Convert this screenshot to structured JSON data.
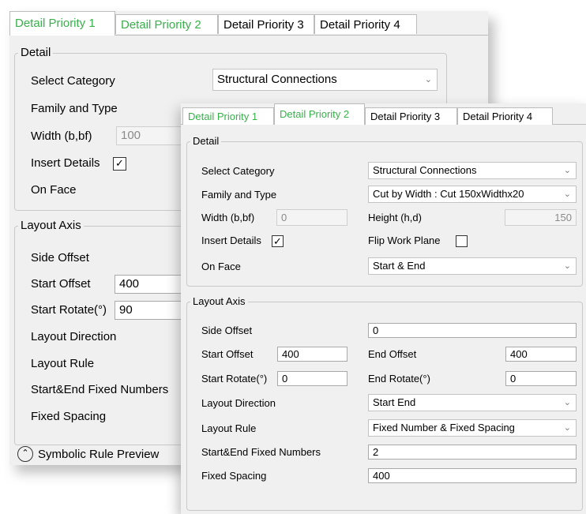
{
  "back": {
    "tabs": [
      "Detail Priority 1",
      "Detail Priority 2",
      "Detail Priority 3",
      "Detail Priority 4"
    ],
    "detail": {
      "legend": "Detail",
      "select_category_label": "Select Category",
      "select_category_value": "Structural Connections",
      "family_type_label": "Family and Type",
      "width_label": "Width (b,bf)",
      "width_value": "100",
      "insert_details_label": "Insert Details",
      "insert_details_checked": "✓",
      "on_face_label": "On Face"
    },
    "layout": {
      "legend": "Layout Axis",
      "side_offset_label": "Side Offset",
      "start_offset_label": "Start Offset",
      "start_offset_value": "400",
      "start_rotate_label": "Start Rotate(°)",
      "start_rotate_value": "90",
      "layout_direction_label": "Layout Direction",
      "layout_rule_label": "Layout Rule",
      "fixed_numbers_label": "Start&End Fixed Numbers",
      "fixed_spacing_label": "Fixed Spacing"
    },
    "symbolic_preview": "Symbolic Rule Preview",
    "symbolic_icon": "⌃"
  },
  "front": {
    "tabs": [
      "Detail Priority 1",
      "Detail Priority 2",
      "Detail Priority 3",
      "Detail Priority 4"
    ],
    "detail": {
      "legend": "Detail",
      "select_category_label": "Select Category",
      "select_category_value": "Structural Connections",
      "family_type_label": "Family and Type",
      "family_type_value": "Cut by Width : Cut 150xWidthx20",
      "width_label": "Width (b,bf)",
      "width_value": "0",
      "height_label": "Height (h,d)",
      "height_value": "150",
      "insert_details_label": "Insert Details",
      "insert_details_checked": "✓",
      "flip_label": "Flip Work Plane",
      "on_face_label": "On Face",
      "on_face_value": "Start & End"
    },
    "layout": {
      "legend": "Layout Axis",
      "side_offset_label": "Side Offset",
      "side_offset_value": "0",
      "start_offset_label": "Start Offset",
      "start_offset_value": "400",
      "end_offset_label": "End Offset",
      "end_offset_value": "400",
      "start_rotate_label": "Start Rotate(°)",
      "start_rotate_value": "0",
      "end_rotate_label": "End Rotate(°)",
      "end_rotate_value": "0",
      "layout_direction_label": "Layout Direction",
      "layout_direction_value": "Start End",
      "layout_rule_label": "Layout Rule",
      "layout_rule_value": "Fixed Number & Fixed Spacing",
      "fixed_numbers_label": "Start&End Fixed Numbers",
      "fixed_numbers_value": "2",
      "fixed_spacing_label": "Fixed Spacing",
      "fixed_spacing_value": "400"
    }
  },
  "icons": {
    "dropdown": "chevron-down-icon",
    "check": "checkmark-icon",
    "preview": "chevron-up-circle-icon"
  },
  "colors": {
    "tab_green": "#37b14a",
    "panel_bg": "#f0f0f0"
  }
}
